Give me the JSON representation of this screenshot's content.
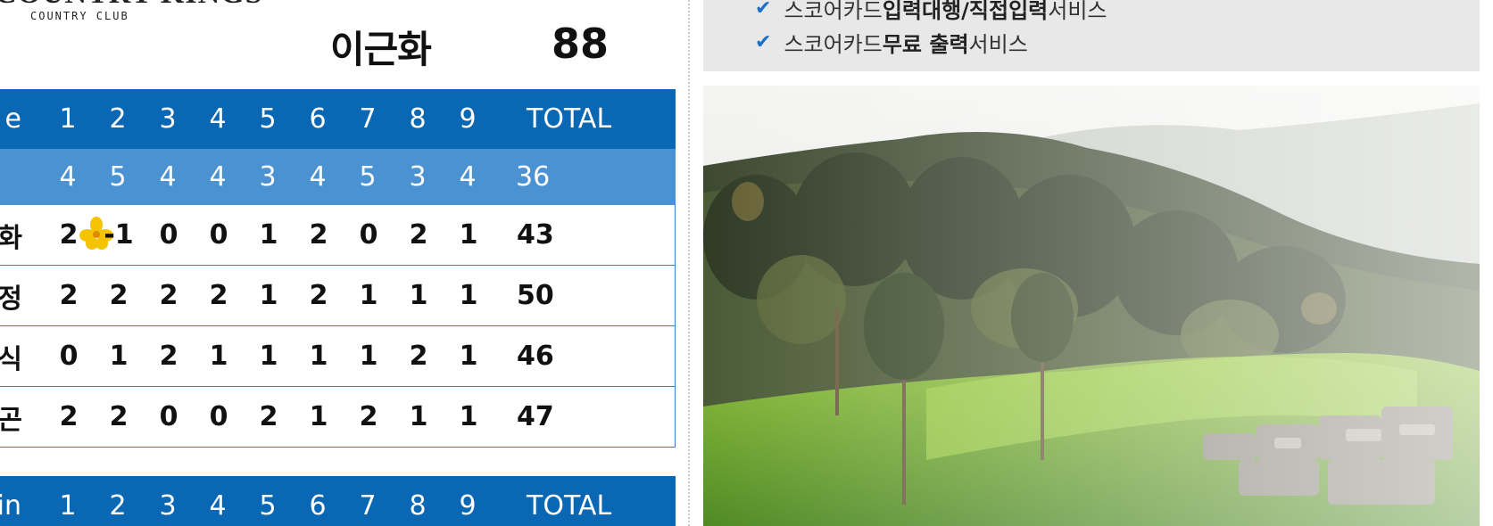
{
  "club": {
    "logo_text": "COUNTRY KINGS",
    "logo_sub": "COUNTRY CLUB"
  },
  "player": {
    "name": "이근화",
    "total": "88"
  },
  "out_table": {
    "header_label": "e",
    "holes": [
      "1",
      "2",
      "3",
      "4",
      "5",
      "6",
      "7",
      "8",
      "9"
    ],
    "total_label": "TOTAL",
    "par_label": "",
    "par": [
      "4",
      "5",
      "4",
      "4",
      "3",
      "4",
      "5",
      "3",
      "4"
    ],
    "par_total": "36",
    "rows": [
      {
        "label": "화",
        "scores": [
          "2",
          "-1",
          "0",
          "0",
          "1",
          "2",
          "0",
          "2",
          "1"
        ],
        "total": "43"
      },
      {
        "label": "정",
        "scores": [
          "2",
          "2",
          "2",
          "2",
          "1",
          "2",
          "1",
          "1",
          "1"
        ],
        "total": "50"
      },
      {
        "label": "식",
        "scores": [
          "0",
          "1",
          "2",
          "1",
          "1",
          "1",
          "1",
          "2",
          "1"
        ],
        "total": "46"
      },
      {
        "label": "곤",
        "scores": [
          "2",
          "2",
          "0",
          "0",
          "2",
          "1",
          "2",
          "1",
          "1"
        ],
        "total": "47"
      }
    ]
  },
  "in_table": {
    "header_label": "ain",
    "holes": [
      "1",
      "2",
      "3",
      "4",
      "5",
      "6",
      "7",
      "8",
      "9"
    ],
    "total_label": "TOTAL"
  },
  "services": [
    {
      "pre": "스코어카드 ",
      "bold": "입력대행/직접입력",
      "post": " 서비스"
    },
    {
      "pre": "스코어카드 ",
      "bold": "무료 출력",
      "post": " 서비스"
    }
  ],
  "colors": {
    "header_blue": "#0967b3",
    "par_blue": "#4b92d3",
    "border_blue": "#3f7bc8",
    "check_blue": "#1d6fc4",
    "info_bg": "#e8e8e8",
    "flower_yellow": "#f5c400"
  },
  "icons": {
    "check": "check-icon",
    "birdie_marker": "flower-icon"
  }
}
